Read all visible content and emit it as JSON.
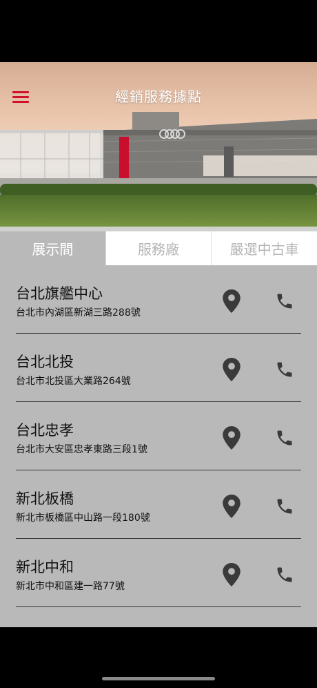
{
  "header": {
    "title": "經銷服務據點",
    "menu_icon": "hamburger-menu-icon",
    "accent_color": "#d0112b"
  },
  "tabs": [
    {
      "label": "展示間",
      "active": true
    },
    {
      "label": "服務廠",
      "active": false
    },
    {
      "label": "嚴選中古車",
      "active": false
    }
  ],
  "locations": [
    {
      "name": "台北旗艦中心",
      "address": "台北市內湖區新湖三路288號"
    },
    {
      "name": "台北北投",
      "address": "台北市北投區大業路264號"
    },
    {
      "name": "台北忠孝",
      "address": "台北市大安區忠孝東路三段1號"
    },
    {
      "name": "新北板橋",
      "address": "新北市板橋區中山路一段180號"
    },
    {
      "name": "新北中和",
      "address": "新北市中和區建一路77號"
    }
  ],
  "row_icons": {
    "map": "map-pin-icon",
    "call": "phone-icon"
  }
}
